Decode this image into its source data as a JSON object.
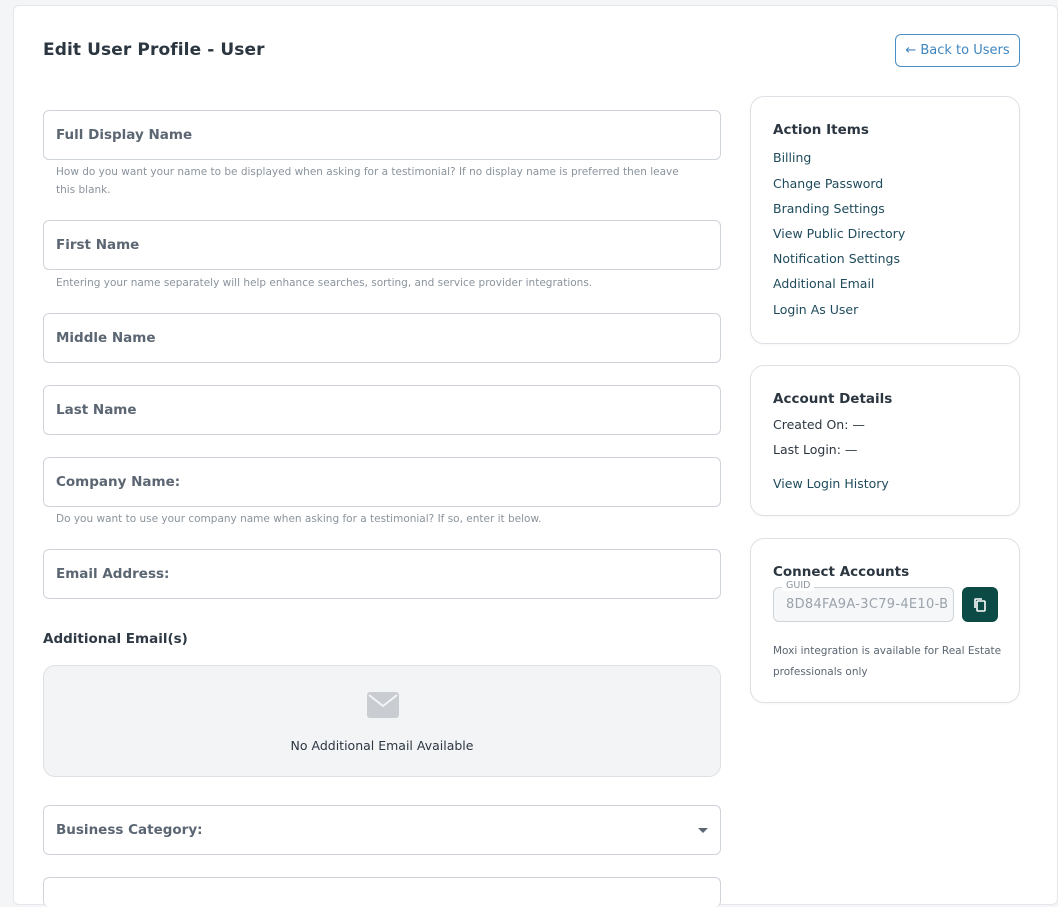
{
  "header": {
    "title": "Edit User Profile - User",
    "back_button": "← Back to Users"
  },
  "form": {
    "full_display_name": {
      "label": "Full Display Name",
      "helper": "How do you want your name to be displayed when asking for a testimonial? If no display name is preferred then leave this blank."
    },
    "first_name": {
      "label": "First Name",
      "helper": "Entering your name separately will help enhance searches, sorting, and service provider integrations."
    },
    "middle_name": {
      "label": "Middle Name"
    },
    "last_name": {
      "label": "Last Name"
    },
    "company_name": {
      "label": "Company Name:",
      "helper": "Do you want to use your company name when asking for a testimonial? If so, enter it below."
    },
    "email_address": {
      "label": "Email Address:"
    },
    "additional_emails": {
      "heading": "Additional Email(s)",
      "empty_text": "No Additional Email Available",
      "icon": "mail-icon"
    },
    "business_category": {
      "label": "Business Category:"
    }
  },
  "sidebar": {
    "action_items": {
      "title": "Action Items",
      "links": [
        "Billing",
        "Change Password",
        "Branding Settings",
        "View Public Directory",
        "Notification Settings",
        "Additional Email",
        "Login As User"
      ]
    },
    "account_details": {
      "title": "Account Details",
      "created_on": "Created On: —",
      "last_login": "Last Login: —",
      "history_link": "View Login History"
    },
    "connect_accounts": {
      "title": "Connect Accounts",
      "guid_label": "GUID",
      "guid_value": "8D84FA9A-3C79-4E10-B",
      "note": "Moxi integration is available for Real Estate professionals only",
      "copy_icon": "copy-icon"
    }
  },
  "colors": {
    "accent_link": "#1f4b5c",
    "back_button": "#3f86c0",
    "copy_button": "#0b4a45"
  }
}
